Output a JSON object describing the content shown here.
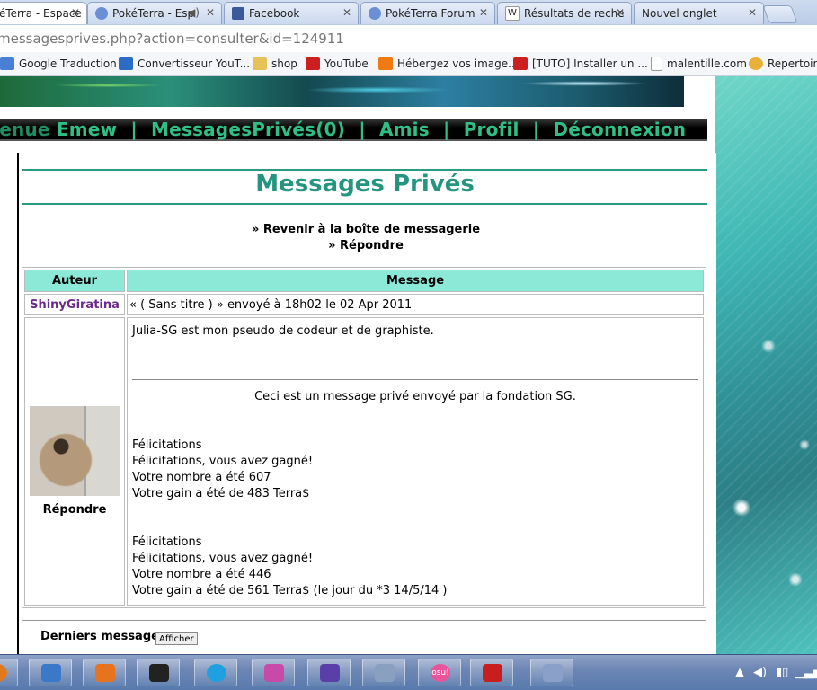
{
  "tabs": [
    {
      "label": "éTerra - Espace",
      "active": true,
      "icon": "pokeball-icon",
      "color": "#cc3333"
    },
    {
      "label": "PokéTerra - Esp",
      "active": false,
      "icon": "pokeball-icon",
      "color": "#6b8fd6"
    },
    {
      "label": "Facebook",
      "active": false,
      "icon": "facebook-icon",
      "color": "#3b5998"
    },
    {
      "label": "PokéTerra Forum",
      "active": false,
      "icon": "pokeball-icon",
      "color": "#6b8fd6"
    },
    {
      "label": "Résultats de reche",
      "active": false,
      "icon": "wikipedia-icon",
      "color": "#444444"
    },
    {
      "label": "Nouvel onglet",
      "active": false,
      "icon": "",
      "color": ""
    }
  ],
  "address": "messagesprives.php?action=consulter&id=124911",
  "bookmarks": [
    {
      "label": "Google Traduction",
      "icon": "translate-icon",
      "color": "#4a7fd6"
    },
    {
      "label": "Convertisseur YouT...",
      "icon": "yt-mp3-icon",
      "color": "#2b6cc8"
    },
    {
      "label": "shop",
      "icon": "folder-icon",
      "color": "#e6c25a"
    },
    {
      "label": "YouTube",
      "icon": "youtube-icon",
      "color": "#cc1f1f"
    },
    {
      "label": "Hébergez vos image...",
      "icon": "orange-icon",
      "color": "#f07a10"
    },
    {
      "label": "[TUTO] Installer un ...",
      "icon": "youtube-icon",
      "color": "#cc1f1f"
    },
    {
      "label": "malentille.com",
      "icon": "page-icon",
      "color": "#dddddd"
    },
    {
      "label": "Repertoire",
      "icon": "web-icon",
      "color": "#e8b23a"
    }
  ],
  "nav": {
    "prefix": "venue",
    "user": "Emew",
    "messages": "MessagesPrivés(0)",
    "amis": "Amis",
    "profil": "Profil",
    "deconnexion": "Déconnexion",
    "sep": "|"
  },
  "page": {
    "title": "Messages Privés",
    "back_link": "» Revenir à la boîte de messagerie",
    "reply_link": "» Répondre"
  },
  "table": {
    "col_author": "Auteur",
    "col_message": "Message",
    "author": "ShinyGiratina",
    "meta": "« ( Sans titre ) » envoyé à 18h02 le 02 Apr 2011",
    "reply": "Répondre",
    "signature": "Julia-SG est mon pseudo de codeur et de graphiste.",
    "notice": "Ceci est un message privé envoyé par la fondation SG.",
    "block1": [
      "Félicitations",
      "Félicitations, vous avez gagné!",
      "Votre nombre a été 607",
      "Votre gain a été de 483 Terra$"
    ],
    "block2": [
      "Félicitations",
      "Félicitations, vous avez gagné!",
      "Votre nombre a été 446",
      "Votre gain a été de 561 Terra$ (le jour du *3 14/5/14 )"
    ]
  },
  "footer": {
    "derniers": "Derniers messages:",
    "afficher": "Afficher"
  },
  "taskbar": {
    "apps": [
      {
        "name": "firefox-icon",
        "color": "#e07a1c"
      },
      {
        "name": "control-panel-icon",
        "color": "#3b78c8"
      },
      {
        "name": "media-player-icon",
        "color": "#e8731f"
      },
      {
        "name": "console-icon",
        "color": "#222222"
      },
      {
        "name": "skype-icon",
        "color": "#1fa0e0"
      },
      {
        "name": "paint-icon",
        "color": "#c84aa8"
      },
      {
        "name": "gameboy-icon",
        "color": "#5a3fa8"
      },
      {
        "name": "calculator-icon",
        "color": "#8aa0c0"
      },
      {
        "name": "osu-icon",
        "color": "#e8559a"
      },
      {
        "name": "acrobat-icon",
        "color": "#c81e1e"
      },
      {
        "name": "lambda-icon",
        "color": "#8aa0c8"
      }
    ],
    "osu_label": "osu!"
  }
}
